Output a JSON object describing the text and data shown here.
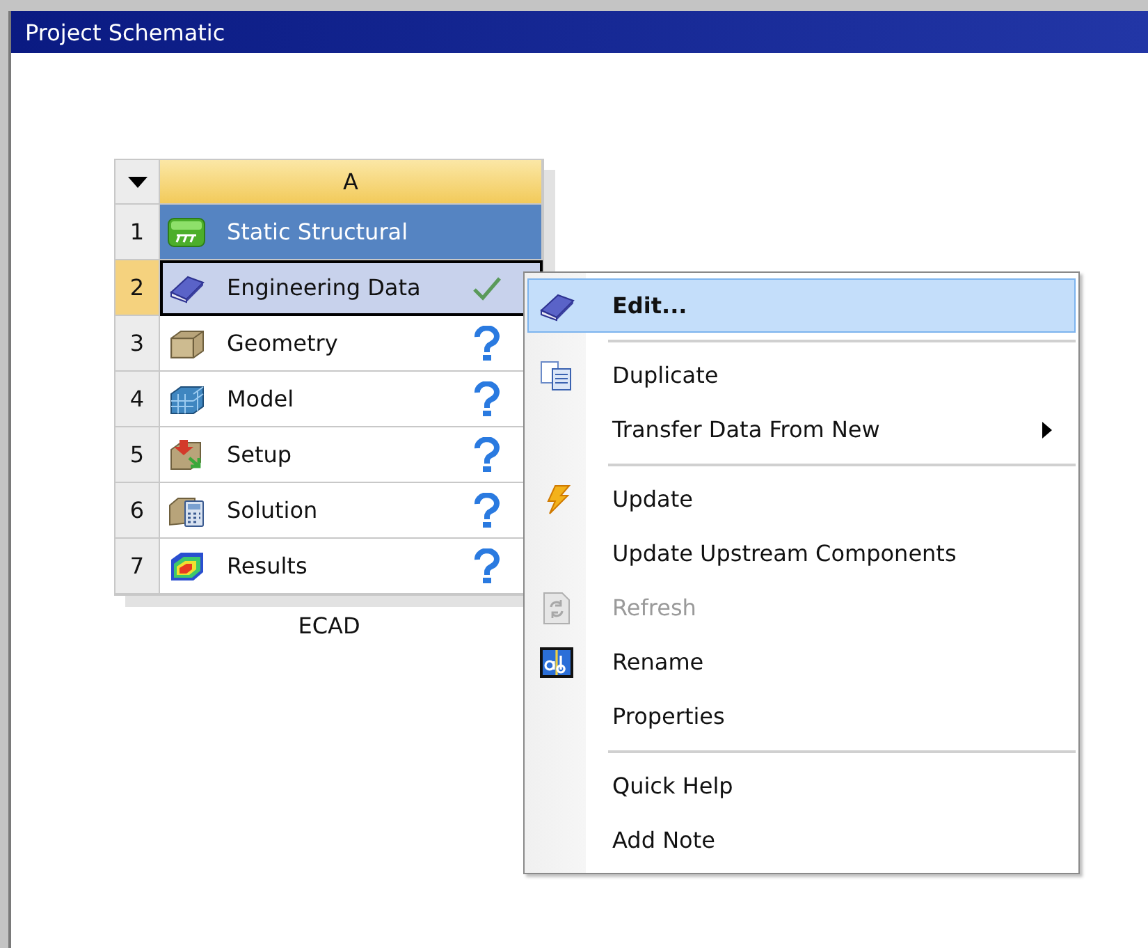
{
  "window": {
    "title": "Project Schematic"
  },
  "system": {
    "column": "A",
    "name": "ECAD",
    "rows": [
      {
        "number": "1",
        "label": "Static Structural",
        "kind": "title",
        "selected": false,
        "up_to_date": false,
        "attention_required": false
      },
      {
        "number": "2",
        "label": "Engineering Data",
        "kind": "cell",
        "selected": true,
        "up_to_date": true,
        "attention_required": false
      },
      {
        "number": "3",
        "label": "Geometry",
        "kind": "cell",
        "selected": false,
        "up_to_date": false,
        "attention_required": true
      },
      {
        "number": "4",
        "label": "Model",
        "kind": "cell",
        "selected": false,
        "up_to_date": false,
        "attention_required": true
      },
      {
        "number": "5",
        "label": "Setup",
        "kind": "cell",
        "selected": false,
        "up_to_date": false,
        "attention_required": true
      },
      {
        "number": "6",
        "label": "Solution",
        "kind": "cell",
        "selected": false,
        "up_to_date": false,
        "attention_required": true
      },
      {
        "number": "7",
        "label": "Results",
        "kind": "cell",
        "selected": false,
        "up_to_date": false,
        "attention_required": true
      }
    ]
  },
  "context_menu": {
    "groups": [
      [
        {
          "label": "Edit...",
          "selected": true,
          "default": true,
          "disabled": false,
          "submenu": false
        }
      ],
      [
        {
          "label": "Duplicate",
          "selected": false,
          "default": false,
          "disabled": false,
          "submenu": false
        },
        {
          "label": "Transfer Data From New",
          "selected": false,
          "default": false,
          "disabled": false,
          "submenu": true
        }
      ],
      [
        {
          "label": "Update",
          "selected": false,
          "default": false,
          "disabled": false,
          "submenu": false
        },
        {
          "label": "Update Upstream Components",
          "selected": false,
          "default": false,
          "disabled": false,
          "submenu": false
        },
        {
          "label": "Refresh",
          "selected": false,
          "default": false,
          "disabled": true,
          "submenu": false
        },
        {
          "label": "Rename",
          "selected": false,
          "default": false,
          "disabled": false,
          "submenu": false
        },
        {
          "label": "Properties",
          "selected": false,
          "default": false,
          "disabled": false,
          "submenu": false
        }
      ],
      [
        {
          "label": "Quick Help",
          "selected": false,
          "default": false,
          "disabled": false,
          "submenu": false
        },
        {
          "label": "Add Note",
          "selected": false,
          "default": false,
          "disabled": false,
          "submenu": false
        }
      ]
    ]
  }
}
